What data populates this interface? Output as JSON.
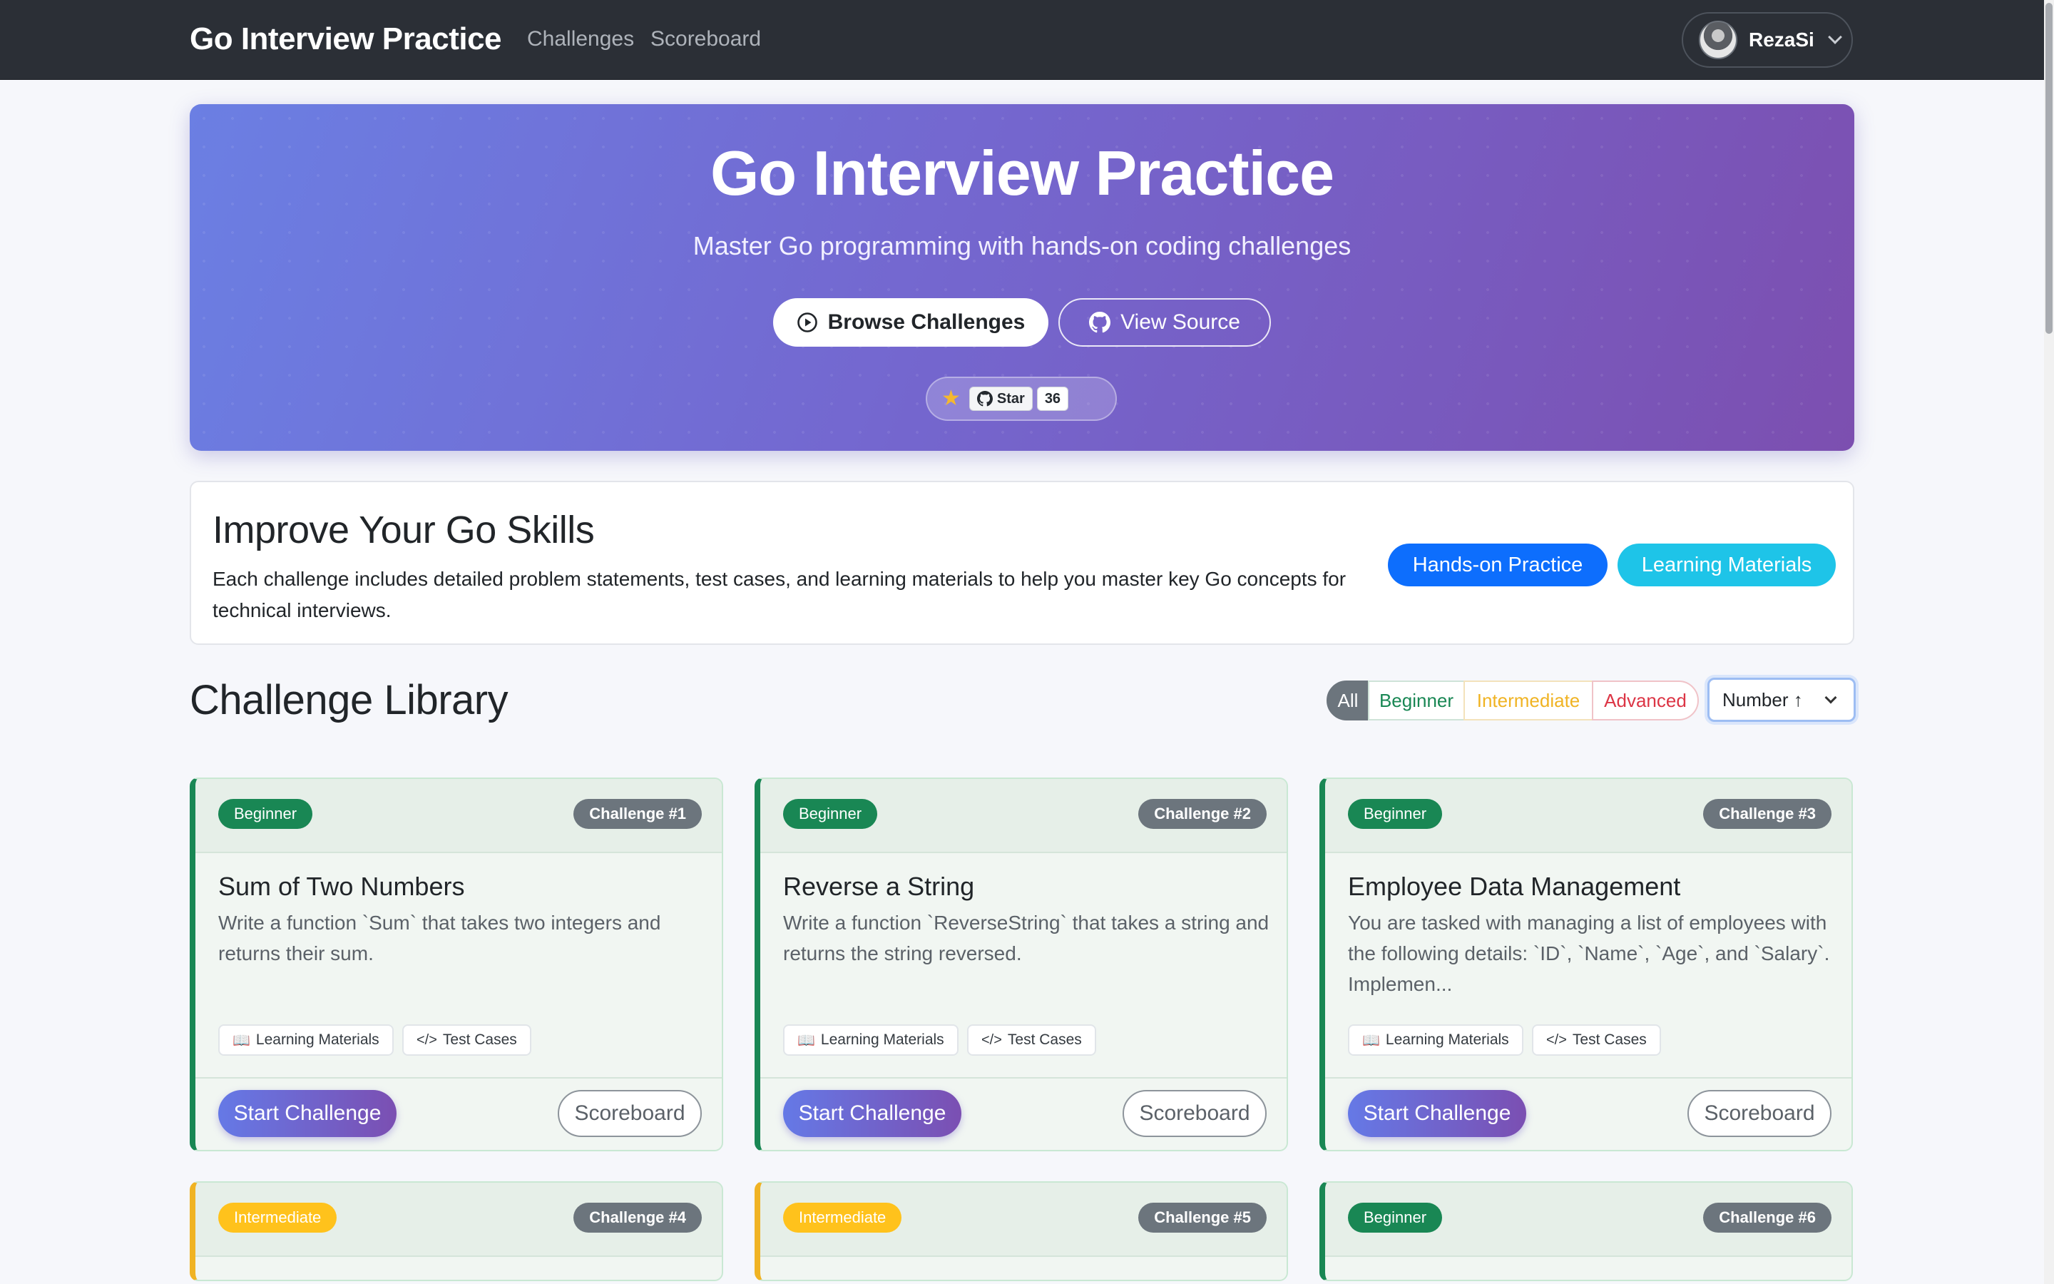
{
  "navbar": {
    "brand": "Go Interview Practice",
    "links": [
      "Challenges",
      "Scoreboard"
    ],
    "user": "RezaSi"
  },
  "hero": {
    "title": "Go Interview Practice",
    "subtitle": "Master Go programming with hands-on coding challenges",
    "browse_label": "Browse Challenges",
    "source_label": "View Source",
    "star_label": "Star",
    "star_count": "36"
  },
  "improve": {
    "title": "Improve Your Go Skills",
    "text": "Each challenge includes detailed problem statements, test cases, and learning materials to help you master key Go concepts for technical interviews.",
    "pill_practice": "Hands-on Practice",
    "pill_materials": "Learning Materials"
  },
  "library": {
    "title": "Challenge Library",
    "filters": [
      "All",
      "Beginner",
      "Intermediate",
      "Advanced"
    ],
    "sort_value": "Number ↑"
  },
  "cards": [
    {
      "level": "Beginner",
      "number": "Challenge #1",
      "title": "Sum of Two Numbers",
      "desc": "Write a function `Sum` that takes two integers and returns their sum.",
      "tag1": "Learning Materials",
      "tag2": "Test Cases",
      "start": "Start Challenge",
      "scoreboard": "Scoreboard"
    },
    {
      "level": "Beginner",
      "number": "Challenge #2",
      "title": "Reverse a String",
      "desc": "Write a function `ReverseString` that takes a string and returns the string reversed.",
      "tag1": "Learning Materials",
      "tag2": "Test Cases",
      "start": "Start Challenge",
      "scoreboard": "Scoreboard"
    },
    {
      "level": "Beginner",
      "number": "Challenge #3",
      "title": "Employee Data Management",
      "desc": "You are tasked with managing a list of employees with the following details: `ID`, `Name`, `Age`, and `Salary`. Implemen...",
      "tag1": "Learning Materials",
      "tag2": "Test Cases",
      "start": "Start Challenge",
      "scoreboard": "Scoreboard"
    },
    {
      "level": "Intermediate",
      "number": "Challenge #4"
    },
    {
      "level": "Intermediate",
      "number": "Challenge #5"
    },
    {
      "level": "Beginner",
      "number": "Challenge #6"
    }
  ]
}
